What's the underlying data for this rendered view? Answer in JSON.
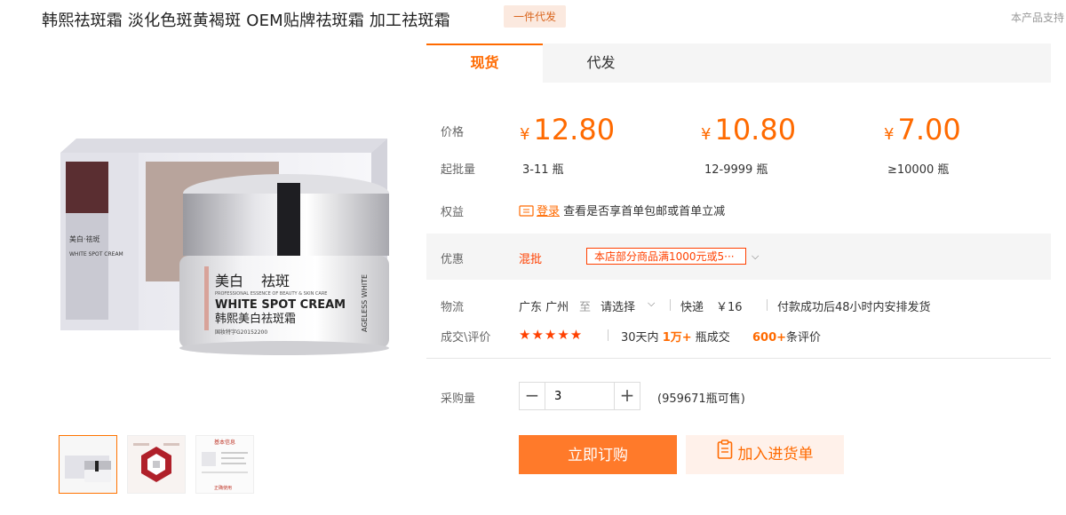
{
  "header": {
    "title": "韩熙祛斑霜 淡化色斑黄褐斑 OEM贴牌祛斑霜 加工祛斑霜",
    "badge": "一件代发",
    "notice": "本产品支持"
  },
  "product_image": {
    "box_text_1": "美白·祛斑",
    "box_text_2": "WHITE SPOT CREAM",
    "jar_title": "美白",
    "jar_title_2": "祛斑",
    "jar_sub": "PROFESSIONAL ESSENCE OF BEAUTY & SKIN CARE",
    "jar_en": "WHITE SPOT CREAM",
    "jar_cn": "韩熙美白祛斑霜",
    "jar_reg": "国妆特字G20152200",
    "jar_side": "AGELESS WHITE",
    "thumb_3_label": "基本信息",
    "thumb_3_footer": "正确使用"
  },
  "tabs": [
    {
      "label": "现货",
      "active": true
    },
    {
      "label": "代发",
      "active": false
    }
  ],
  "pricing": {
    "price_label": "价格",
    "moq_label": "起批量",
    "currency": "¥",
    "tiers": [
      {
        "price": "12.80",
        "range": "3-11 瓶"
      },
      {
        "price": "10.80",
        "range": "12-9999 瓶"
      },
      {
        "price": "7.00",
        "range": "≥10000 瓶"
      }
    ]
  },
  "rights": {
    "label": "权益",
    "login": "登录",
    "text": "查看是否享首单包邮或首单立减"
  },
  "promo": {
    "label": "优惠",
    "type": "混批",
    "coupon": "本店部分商品满1000元或5···"
  },
  "logistics": {
    "label": "物流",
    "origin": "广东 广州",
    "to": "至",
    "dest": "请选择",
    "method": "快递",
    "fee": "￥16",
    "note": "付款成功后48小时内安排发货"
  },
  "reviews": {
    "label": "成交\\评价",
    "stars": "★★★★★",
    "pre": "30天内",
    "count": "1万+",
    "post": "瓶成交",
    "review_count": "600+",
    "review_post": "条评价"
  },
  "purchase": {
    "label": "采购量",
    "qty": "3",
    "minus": "−",
    "plus": "+",
    "available": "(959671瓶可售)"
  },
  "actions": {
    "buy": "立即订购",
    "cart": "加入进货单"
  },
  "colors": {
    "accent": "#ff6a00",
    "promo_red": "#ff4000",
    "buy_bg": "#ff7a2a"
  }
}
